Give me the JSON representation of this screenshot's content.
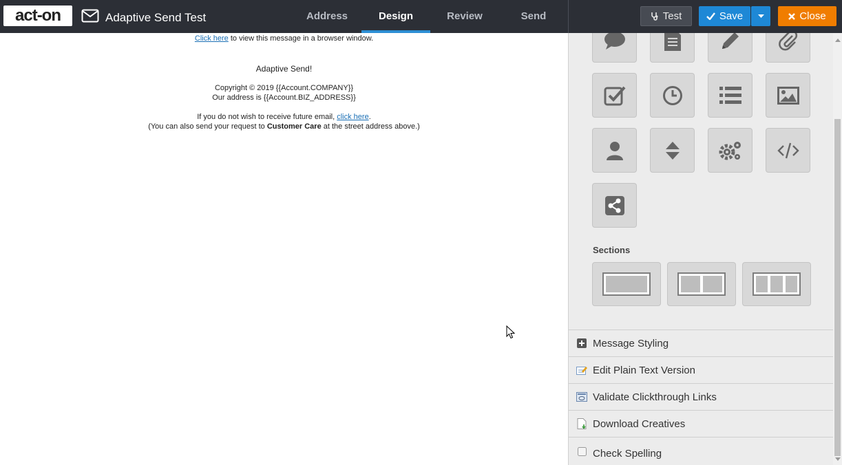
{
  "header": {
    "logo_text": "act-on",
    "message_title": "Adaptive Send Test",
    "tabs": [
      {
        "label": "Address"
      },
      {
        "label": "Design"
      },
      {
        "label": "Review"
      },
      {
        "label": "Send"
      }
    ],
    "active_tab": "Design",
    "test_label": "Test",
    "save_label": "Save",
    "close_label": "Close"
  },
  "email": {
    "view_link": "Click here",
    "view_text": " to view this message in a browser window.",
    "heading": "Adaptive Send!",
    "copyright": "Copyright © 2019 {{Account.COMPANY}}",
    "address": "Our address is {{Account.BIZ_ADDRESS}}",
    "unsub_text": "If you do not wish to receive future email, ",
    "unsub_link": "click here",
    "unsub_end": ".",
    "care_pre": "(You can also send your request to ",
    "care_bold": "Customer Care",
    "care_post": " at the street address above.)"
  },
  "sidebar": {
    "blocks": [
      {
        "icon": "speech-bubble-icon"
      },
      {
        "icon": "document-icon"
      },
      {
        "icon": "pencil-icon"
      },
      {
        "icon": "paperclip-icon"
      },
      {
        "icon": "checkbox-icon"
      },
      {
        "icon": "clock-icon"
      },
      {
        "icon": "list-icon"
      },
      {
        "icon": "image-icon"
      },
      {
        "icon": "person-icon"
      },
      {
        "icon": "spacer-arrows-icon"
      },
      {
        "icon": "gears-icon"
      },
      {
        "icon": "code-icon"
      },
      {
        "icon": "share-icon"
      }
    ],
    "sections_label": "Sections",
    "sections": [
      {
        "columns": 1
      },
      {
        "columns": 2
      },
      {
        "columns": 3
      }
    ],
    "menu": [
      {
        "label": "Message Styling",
        "icon": "plus-square-icon"
      },
      {
        "label": "Edit Plain Text Version",
        "icon": "edit-note-icon"
      },
      {
        "label": "Validate Clickthrough Links",
        "icon": "validate-links-icon"
      },
      {
        "label": "Download Creatives",
        "icon": "download-doc-icon"
      },
      {
        "label": "Check Spelling",
        "icon": "checkbox-empty-icon"
      }
    ]
  },
  "colors": {
    "topbar": "#2c2f36",
    "accent_blue": "#1e88d6",
    "close_orange": "#f07d00",
    "sidebar_bg": "#ececec",
    "tile_bg": "#d8d8d8",
    "icon_gray": "#666666"
  }
}
